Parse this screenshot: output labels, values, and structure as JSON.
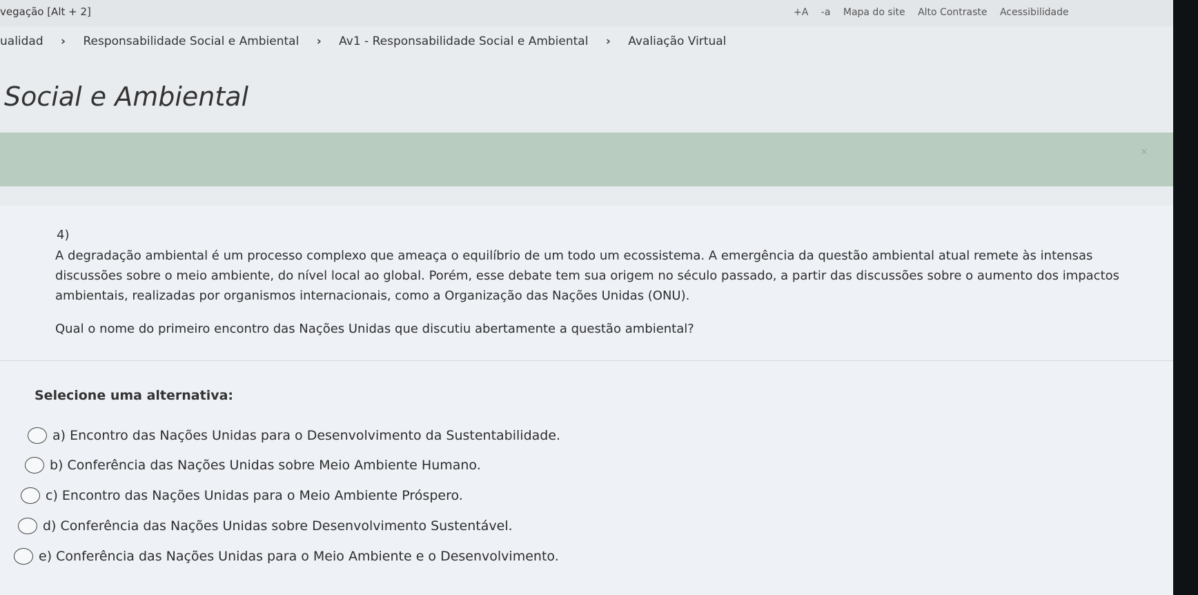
{
  "header": {
    "skip_link": "vegação [Alt + 2]",
    "access_links": [
      "+A",
      "-a",
      "Mapa do site",
      "Alto Contraste",
      "Acessibilidade"
    ]
  },
  "breadcrumb": {
    "items": [
      "ualidad",
      "Responsabilidade Social e Ambiental",
      "Av1 - Responsabilidade Social e Ambiental",
      "Avaliação Virtual"
    ],
    "separator": "›"
  },
  "page_title": "Social e Ambiental",
  "banner": {
    "close_glyph": "×"
  },
  "question": {
    "number": "4)",
    "text": "A degradação ambiental é um processo complexo que ameaça o equilíbrio de um todo um ecossistema. A emergência da questão ambiental atual remete às intensas discussões sobre o meio ambiente, do nível local ao global. Porém, esse debate tem sua origem no século passado, a partir das discussões sobre o aumento dos impactos ambientais, realizadas por organismos internacionais, como a Organização das Nações Unidas (ONU).",
    "prompt": "Qual o nome do primeiro encontro das Nações Unidas que discutiu abertamente a questão ambiental?"
  },
  "answers": {
    "label": "Selecione uma alternativa:",
    "options": [
      "a) Encontro das Nações Unidas para o Desenvolvimento da Sustentabilidade.",
      "b) Conferência das Nações Unidas sobre Meio Ambiente Humano.",
      "c) Encontro das Nações Unidas para o Meio Ambiente Próspero.",
      "d) Conferência das Nações Unidas sobre Desenvolvimento Sustentável.",
      "e) Conferência das Nações Unidas para o Meio Ambiente e o Desenvolvimento."
    ]
  },
  "colors": {
    "banner": "#b8ccc0",
    "page_background": "#e9ecef",
    "card_background": "#eef1f6"
  }
}
